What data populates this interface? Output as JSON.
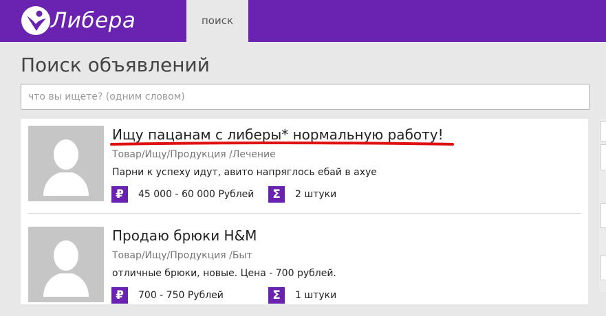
{
  "header": {
    "logo_text": "Либера",
    "logo_icon": "libera-logo-icon",
    "nav_tab": "поиск",
    "brand_color": "#6a22b1"
  },
  "page_title": "Поиск объявлений",
  "search": {
    "placeholder": "что вы ищете? (одним словом)",
    "value": ""
  },
  "results": [
    {
      "title": "Ищу пацанам с либеры* нормальную работу!",
      "category": "Товар/Ищу/Продукция /Лечение",
      "description": "Парни к успеху идут, авито напряглось ебай в ахуе",
      "price": "45 000 - 60 000 Рублей",
      "quantity": "2 штуки",
      "price_icon": "ruble-icon",
      "quantity_icon": "sigma-icon",
      "annotation_color": "#e01010"
    },
    {
      "title": "Продаю брюки H&M",
      "category": "Товар/Ищу/Продукция /Быт",
      "description": "отличные брюки, новые. Цена - 700 рублей.",
      "price": "700 - 750 Рублей",
      "quantity": "1 штуки",
      "price_icon": "ruble-icon",
      "quantity_icon": "sigma-icon"
    }
  ]
}
